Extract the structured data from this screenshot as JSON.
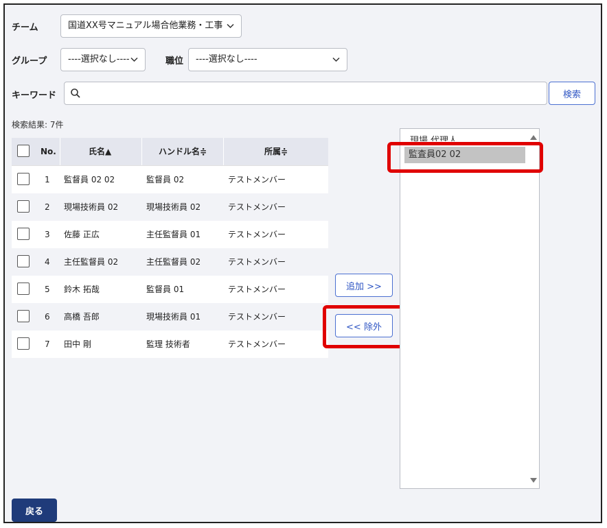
{
  "filters": {
    "team_label": "チーム",
    "team_value": "国道XX号マニュアル場合他業務・工事",
    "group_label": "グループ",
    "group_value": "----選択なし----",
    "position_label": "職位",
    "position_value": "----選択なし----",
    "keyword_label": "キーワード",
    "keyword_value": "",
    "search_button": "検索"
  },
  "results": {
    "count_text": "検索結果: 7件",
    "columns": [
      "No.",
      "氏名▲",
      "ハンドル名≑",
      "所属≑"
    ],
    "rows": [
      {
        "no": "1",
        "name": "監督員 02 02",
        "handle": "監督員 02",
        "affiliation": "テストメンバー"
      },
      {
        "no": "2",
        "name": "現場技術員 02",
        "handle": "現場技術員 02",
        "affiliation": "テストメンバー"
      },
      {
        "no": "3",
        "name": "佐藤 正広",
        "handle": "主任監督員 01",
        "affiliation": "テストメンバー"
      },
      {
        "no": "4",
        "name": "主任監督員 02",
        "handle": "主任監督員 02",
        "affiliation": "テストメンバー"
      },
      {
        "no": "5",
        "name": "鈴木 拓哉",
        "handle": "監督員 01",
        "affiliation": "テストメンバー"
      },
      {
        "no": "6",
        "name": "高橋 吾郎",
        "handle": "現場技術員 01",
        "affiliation": "テストメンバー"
      },
      {
        "no": "7",
        "name": "田中 剛",
        "handle": "監理 技術者",
        "affiliation": "テストメンバー"
      }
    ]
  },
  "transfer": {
    "add_button": "追加 >>",
    "remove_button": "<< 除外"
  },
  "selected_list": {
    "header": "現場 代理人",
    "items": [
      "監査員02 02"
    ]
  },
  "footer": {
    "back_button": "戻る"
  },
  "colors": {
    "accent": "#2f56c4",
    "primary_button": "#1f3b7a",
    "highlight": "#e00000"
  }
}
